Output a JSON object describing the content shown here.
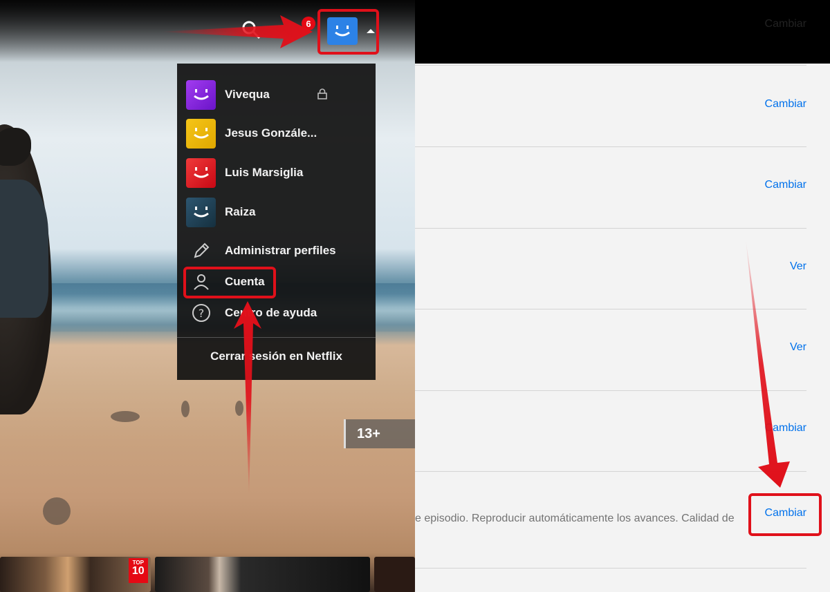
{
  "left": {
    "notification_count": "6",
    "profiles": [
      {
        "name": "Vivequa",
        "color": "#8a2be2",
        "locked": true
      },
      {
        "name": "Jesus Gonzále...",
        "color": "#f0b90b",
        "locked": false
      },
      {
        "name": "Luis Marsiglia",
        "color": "#e50914",
        "locked": false
      },
      {
        "name": "Raiza",
        "color": "#1e3d50",
        "locked": false
      }
    ],
    "menu": {
      "manage_profiles": "Administrar perfiles",
      "account": "Cuenta",
      "help_center": "Centro de ayuda",
      "sign_out": "Cerrar sesión en Netflix"
    },
    "maturity_rating": "13+",
    "top10_badge": {
      "line1": "TOP",
      "line2": "10"
    }
  },
  "right": {
    "topbar_link": "Cambiar",
    "rows": [
      {
        "action": "Cambiar"
      },
      {
        "action": "Cambiar"
      },
      {
        "action": "Ver"
      },
      {
        "action": "Ver"
      },
      {
        "action": "Cambiar"
      },
      {
        "action": "Cambiar",
        "description": "e episodio. Reproducir automáticamente los avances. Calidad de"
      }
    ]
  },
  "colors": {
    "netflix_red": "#e50914",
    "highlight_red": "#e0101a",
    "link_blue": "#0071eb",
    "main_avatar_blue": "#2c82e6"
  }
}
